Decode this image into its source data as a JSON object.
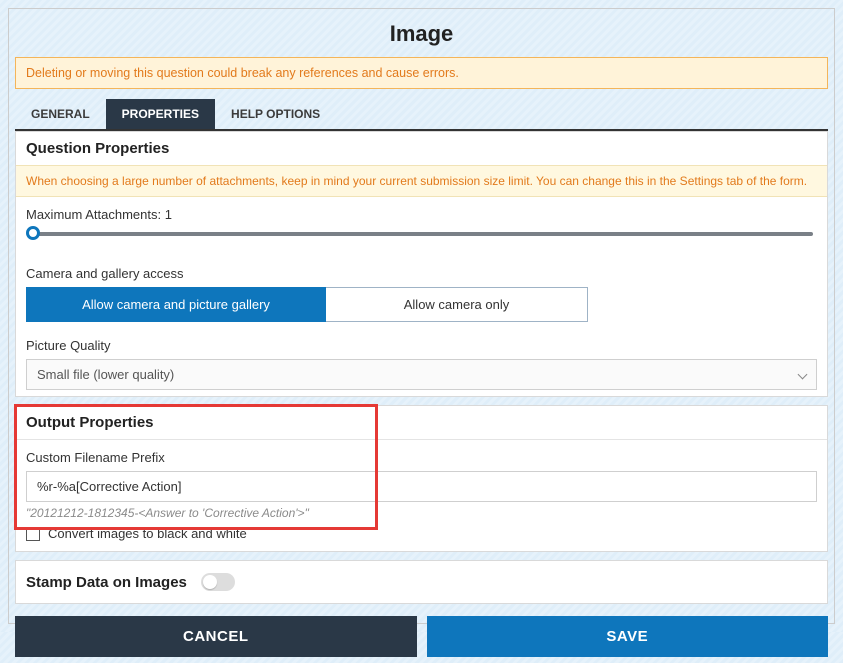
{
  "title": "Image",
  "delete_warning": "Deleting or moving this question could break any references and cause errors.",
  "tabs": {
    "general": "GENERAL",
    "properties": "PROPERTIES",
    "help": "HELP OPTIONS"
  },
  "question_props": {
    "heading": "Question Properties",
    "info": "When choosing a large number of attachments, keep in mind your current submission size limit. You can change this in the Settings tab of the form.",
    "max_attach_label": "Maximum Attachments: 1",
    "camera_label": "Camera and gallery access",
    "camera_opt_both": "Allow camera and picture gallery",
    "camera_opt_only": "Allow camera only",
    "quality_label": "Picture Quality",
    "quality_value": "Small file (lower quality)"
  },
  "output_props": {
    "heading": "Output Properties",
    "filename_label": "Custom Filename Prefix",
    "filename_value": "%r-%a[Corrective Action]",
    "filename_hint": "\"20121212-1812345-<Answer to 'Corrective Action'>\"",
    "convert_bw_label": "Convert images to black and white"
  },
  "stamp": {
    "label": "Stamp Data on Images"
  },
  "buttons": {
    "cancel": "CANCEL",
    "save": "SAVE"
  }
}
